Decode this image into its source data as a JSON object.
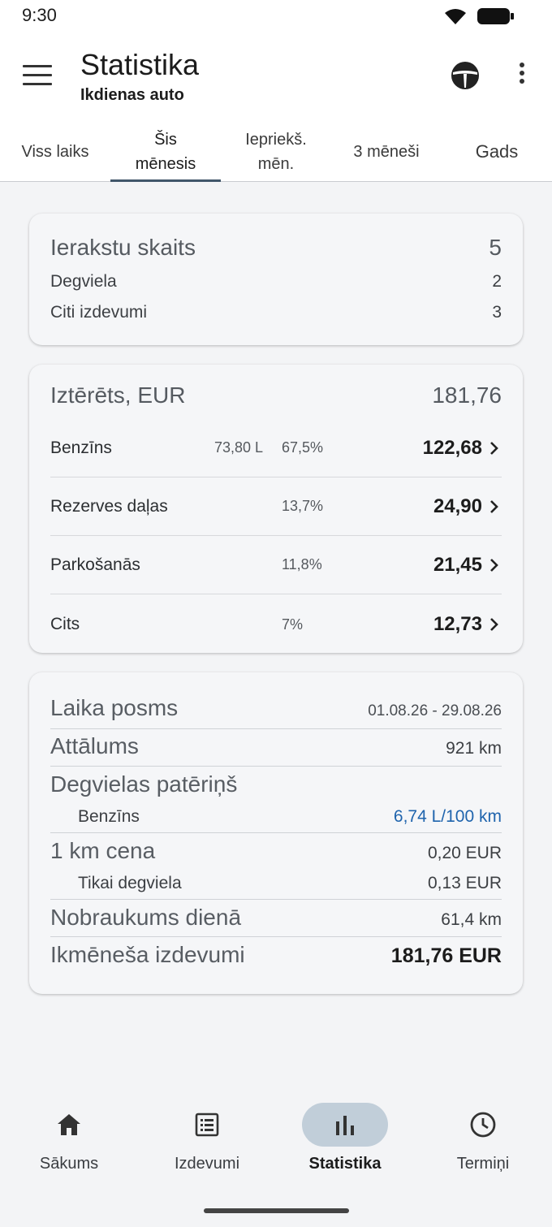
{
  "status": {
    "time": "9:30"
  },
  "appbar": {
    "title": "Statistika",
    "subtitle": "Ikdienas auto"
  },
  "tabs": [
    {
      "label": "Viss laiks"
    },
    {
      "label": "Šis\nmēnesis"
    },
    {
      "label": "Iepriekš.\nmēn."
    },
    {
      "label": "3 mēneši"
    },
    {
      "label": "Gads"
    }
  ],
  "records": {
    "title": "Ierakstu skaits",
    "total": "5",
    "items": [
      {
        "label": "Degviela",
        "value": "2"
      },
      {
        "label": "Citi izdevumi",
        "value": "3"
      }
    ]
  },
  "spent": {
    "title": "Iztērēts, EUR",
    "total": "181,76",
    "items": [
      {
        "name": "Benzīns",
        "volume": "73,80 L",
        "percent": "67,5%",
        "amount": "122,68"
      },
      {
        "name": "Rezerves daļas",
        "volume": "",
        "percent": "13,7%",
        "amount": "24,90"
      },
      {
        "name": "Parkošanās",
        "volume": "",
        "percent": "11,8%",
        "amount": "21,45"
      },
      {
        "name": "Cits",
        "volume": "",
        "percent": "7%",
        "amount": "12,73"
      }
    ]
  },
  "period": {
    "range_label": "Laika posms",
    "range_value": "01.08.26 - 29.08.26",
    "distance_label": "Attālums",
    "distance_value": "921 km",
    "consumption_label": "Degvielas patēriņš",
    "fuel_label": "Benzīns",
    "fuel_value": "6,74 L/100 km",
    "km_cost_label": "1 km cena",
    "km_cost_value": "0,20 EUR",
    "fuel_only_label": "Tikai degviela",
    "fuel_only_value": "0,13 EUR",
    "daily_label": "Nobraukums dienā",
    "daily_value": "61,4 km",
    "monthly_label": "Ikmēneša izdevumi",
    "monthly_value": "181,76 EUR"
  },
  "nav": [
    {
      "label": "Sākums",
      "icon": "home-icon"
    },
    {
      "label": "Izdevumi",
      "icon": "list-icon"
    },
    {
      "label": "Statistika",
      "icon": "bar-chart-icon"
    },
    {
      "label": "Termiņi",
      "icon": "clock-icon"
    }
  ],
  "colors": {
    "accent_tab": "#41566a",
    "nav_active": "#c1ced9",
    "link_blue": "#1f64ad"
  }
}
